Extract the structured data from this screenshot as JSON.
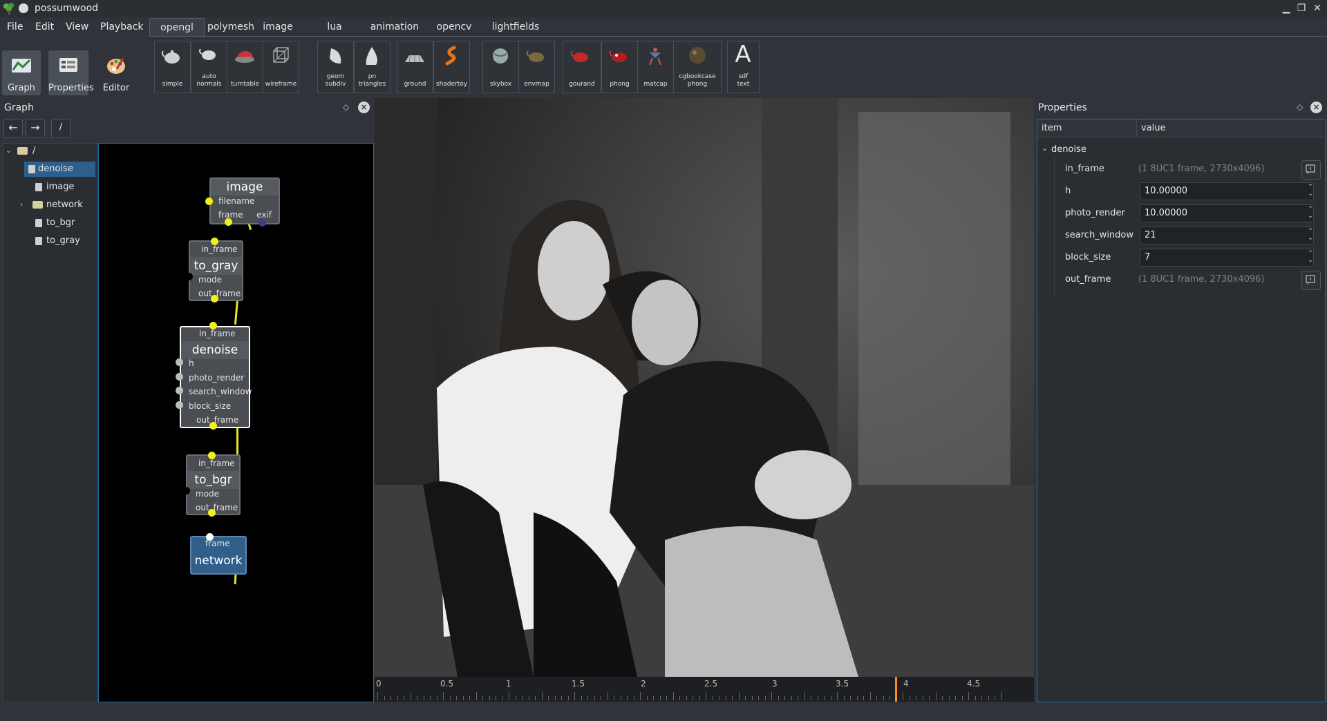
{
  "window": {
    "title": "possumwood",
    "buttons": {
      "minimize": "▁",
      "maximize": "❐",
      "close": "✕"
    }
  },
  "menu": [
    "File",
    "Edit",
    "View",
    "Playback"
  ],
  "main_tools": [
    {
      "label": "Graph",
      "icon": "graph-icon",
      "active": true
    },
    {
      "label": "Properties",
      "icon": "properties-icon",
      "active": true
    },
    {
      "label": "Editor",
      "icon": "editor-palette-icon",
      "active": false
    }
  ],
  "tabs": [
    {
      "label": "opengl",
      "active": true
    },
    {
      "label": "polymesh",
      "active": false
    },
    {
      "label": "image",
      "active": false
    },
    {
      "label": "lua",
      "active": false
    },
    {
      "label": "animation",
      "active": false
    },
    {
      "label": "opencv",
      "active": false
    },
    {
      "label": "lightfields",
      "active": false
    }
  ],
  "shelf": [
    {
      "label": "simple",
      "label2": "",
      "icon": "teapot-icon"
    },
    {
      "label": "auto",
      "label2": "normals",
      "icon": "teapot-normals-icon"
    },
    {
      "label": "turntable",
      "label2": "",
      "icon": "turntable-car-icon"
    },
    {
      "label": "wireframe",
      "label2": "",
      "icon": "wireframe-cube-icon"
    },
    {
      "label": "geom",
      "label2": "subdiv",
      "icon": "geom-subdiv-icon"
    },
    {
      "label": "pn",
      "label2": "triangles",
      "icon": "pn-triangles-icon"
    },
    {
      "label": "ground",
      "label2": "",
      "icon": "ground-grid-icon"
    },
    {
      "label": "shadertoy",
      "label2": "",
      "icon": "shadertoy-icon"
    },
    {
      "label": "skybox",
      "label2": "",
      "icon": "skybox-sphere-icon"
    },
    {
      "label": "envmap",
      "label2": "",
      "icon": "envmap-teapot-icon"
    },
    {
      "label": "gourand",
      "label2": "",
      "icon": "gourand-teapot-icon"
    },
    {
      "label": "phong",
      "label2": "",
      "icon": "phong-teapot-icon"
    },
    {
      "label": "matcap",
      "label2": "",
      "icon": "matcap-figure-icon"
    },
    {
      "label": "cgbookcase",
      "label2": "phong",
      "icon": "cgbookcase-sphere-icon"
    },
    {
      "label": "sdf",
      "label2": "text",
      "icon": "sdf-text-icon",
      "glyph": "A"
    }
  ],
  "graph": {
    "title": "Graph",
    "path": "/",
    "tree": [
      {
        "label": "/",
        "type": "root"
      },
      {
        "label": "denoise",
        "type": "node",
        "selected": true
      },
      {
        "label": "image",
        "type": "node"
      },
      {
        "label": "network",
        "type": "folder"
      },
      {
        "label": "to_bgr",
        "type": "node"
      },
      {
        "label": "to_gray",
        "type": "node"
      }
    ],
    "nodes": {
      "image": {
        "title": "image",
        "ports": [
          "filename",
          "frame",
          "exif"
        ]
      },
      "to_gray": {
        "title": "to_gray",
        "ports": [
          "in_frame",
          "mode",
          "out_frame"
        ]
      },
      "denoise": {
        "title": "denoise",
        "ports": [
          "in_frame",
          "h",
          "photo_render",
          "search_window",
          "block_size",
          "out_frame"
        ]
      },
      "to_bgr": {
        "title": "to_bgr",
        "ports": [
          "in_frame",
          "mode",
          "out_frame"
        ]
      },
      "network": {
        "title": "network",
        "ports": [
          "frame"
        ]
      }
    }
  },
  "timeline": {
    "labels": [
      "0",
      "0.5",
      "1",
      "1.5",
      "2",
      "2.5",
      "3",
      "3.5",
      "4",
      "4.5"
    ],
    "current": 3.95,
    "colors": {
      "cursor": "#ff8c1a"
    }
  },
  "properties": {
    "title": "Properties",
    "columns": [
      "item",
      "value"
    ],
    "group": "denoise",
    "rows": [
      {
        "name": "in_frame",
        "value": "(1 8UC1 frame, 2730x4096)",
        "kind": "info"
      },
      {
        "name": "h",
        "value": "10.00000",
        "kind": "spin"
      },
      {
        "name": "photo_render",
        "value": "10.00000",
        "kind": "spin"
      },
      {
        "name": "search_window",
        "value": "21",
        "kind": "spin"
      },
      {
        "name": "block_size",
        "value": "7",
        "kind": "spin"
      },
      {
        "name": "out_frame",
        "value": "(1 8UC1 frame, 2730x4096)",
        "kind": "info"
      }
    ]
  }
}
